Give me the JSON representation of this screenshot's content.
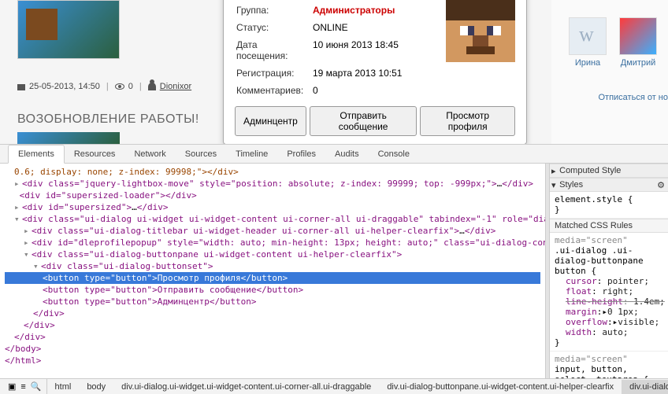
{
  "post": {
    "date": "25-05-2013, 14:50",
    "views": "0",
    "author": "Dionixor",
    "title": "ВОЗОБНОВЛЕНИЕ РАБОТЫ!"
  },
  "profile": {
    "group_label": "Группа:",
    "group_value": "Администраторы",
    "status_label": "Статус:",
    "status_value": "ONLINE",
    "visit_label": "Дата посещения:",
    "visit_value": "10 июня 2013 18:45",
    "reg_label": "Регистрация:",
    "reg_value": "19 марта 2013 10:51",
    "comments_label": "Комментариев:",
    "comments_value": "0",
    "btn_admin": "Админцентр",
    "btn_message": "Отправить сообщение",
    "btn_view": "Просмотр профиля"
  },
  "sidebar": {
    "irina": "Ирина",
    "dmitry": "Дмитрий",
    "unsubscribe": "Отписаться от но"
  },
  "devtools": {
    "tabs": [
      "Elements",
      "Resources",
      "Network",
      "Sources",
      "Timeline",
      "Profiles",
      "Audits",
      "Console"
    ],
    "crumbs": [
      "html",
      "body",
      "div.ui-dialog.ui-widget.ui-widget-content.ui-corner-all.ui-draggable",
      "div.ui-dialog-buttonpane.ui-widget-content.ui-helper-clearfix",
      "div.ui-dialog-buttonset"
    ],
    "styles": {
      "computed_head": "Computed Style",
      "styles_head": "Styles",
      "element_style": "element.style {",
      "brace_close": "}",
      "matched_head": "Matched CSS Rules",
      "media_screen": "media=\"screen\"",
      "rule1_sel": ".ui-dialog .ui-dialog-buttonpane button {",
      "rule1_p1n": "cursor",
      "rule1_p1v": "pointer;",
      "rule1_p2n": "float",
      "rule1_p2v": "right;",
      "rule1_p3n": "line-height",
      "rule1_p3v": "1.4em;",
      "rule1_p4n": "margin",
      "rule1_p4v": "0 1px;",
      "rule1_p5n": "overflow",
      "rule1_p5v": "visible;",
      "rule1_p6n": "width",
      "rule1_p6v": "auto;",
      "rule2_sel": "input, button, select, textarea {"
    },
    "dom": {
      "l0": "0.6; display: none; z-index: 99998;\"></div>",
      "l1a": "<div class=\"jquery-lightbox-move\" style=\"position: absolute; z-index: 99999; top: -999px;\">",
      "l1b": "…",
      "l1c": "</div>",
      "l2": "<div id=\"supersized-loader\"></div>",
      "l3a": "<div id=\"supersized\">",
      "l3b": "…",
      "l3c": "</div>",
      "l4": "<div class=\"ui-dialog ui-widget ui-widget-content ui-corner-all ui-draggable\" tabindex=\"-1\" role=\"dialog\" aria-labelledby=\"ui-dialog-title-dleprofilepopup\" style=\"display: block; z-index: 1002; outline: 0px; height: auto; width: 450px; top: 617.4444580078125px; left: 334px;\">",
      "l5a": "<div class=\"ui-dialog-titlebar ui-widget-header ui-corner-all ui-helper-clearfix\">",
      "l5b": "…",
      "l5c": "</div>",
      "l6": "<div id=\"dleprofilepopup\" style=\"width: auto; min-height: 13px; height: auto;\" class=\"ui-dialog-content ui-widget-content\" scrolltop=\"0\" scrollleft=\"0\">",
      "l6b": "…",
      "l6c": "</div>",
      "l7": "<div class=\"ui-dialog-buttonpane ui-widget-content ui-helper-clearfix\">",
      "l8": "<div class=\"ui-dialog-buttonset\">",
      "l9": "<button type=\"button\">Просмотр профиля</button>",
      "l10": "<button type=\"button\">Отправить сообщение</button>",
      "l11": "<button type=\"button\">Админцентр</button>",
      "l12": "</div>",
      "l13": "</div>",
      "l14": "</div>",
      "l15": "</body>",
      "l16": "</html>"
    }
  }
}
